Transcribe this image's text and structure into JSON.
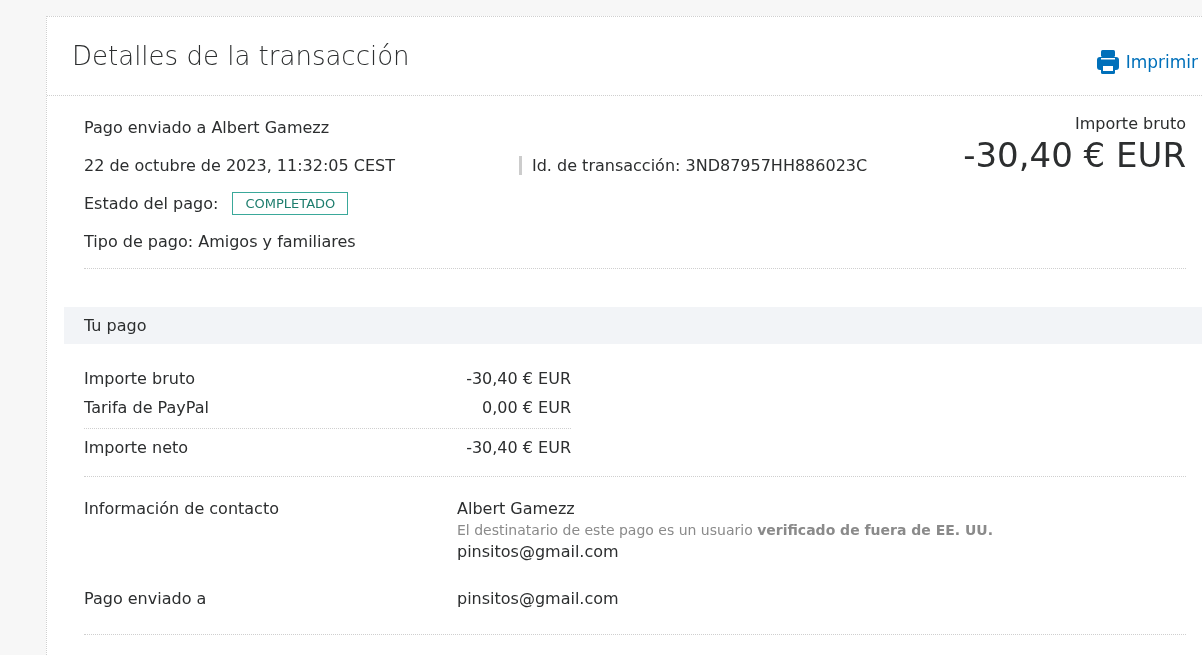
{
  "header": {
    "title": "Detalles de la transacción",
    "print_link": "Imprimir"
  },
  "summary": {
    "recipient_line": "Pago enviado a Albert Gamezz",
    "date": "22 de octubre de 2023, 11:32:05 CEST",
    "transaction_id": "Id. de transacción: 3ND87957HH886023C",
    "status_label": "Estado del pago:",
    "status_badge": "COMPLETADO",
    "payment_type": "Tipo de pago: Amigos y familiares",
    "amount_label": "Importe bruto",
    "amount": "-30,40 € EUR"
  },
  "your_payment": {
    "title": "Tu pago",
    "amounts": [
      {
        "label": "Importe bruto",
        "value": "-30,40 € EUR"
      },
      {
        "label": "Tarifa de PayPal",
        "value": "0,00 € EUR"
      },
      {
        "label": "Importe neto",
        "value": "-30,40 € EUR"
      }
    ]
  },
  "contact": {
    "label": "Información de contacto",
    "name": "Albert Gamezz",
    "note": "El destinatario de este pago es un usuario **verificado de fuera de EE. UU.**",
    "email": "pinsitos@gmail.com"
  },
  "sent_to": {
    "label": "Pago enviado a",
    "value": "pinsitos@gmail.com"
  }
}
